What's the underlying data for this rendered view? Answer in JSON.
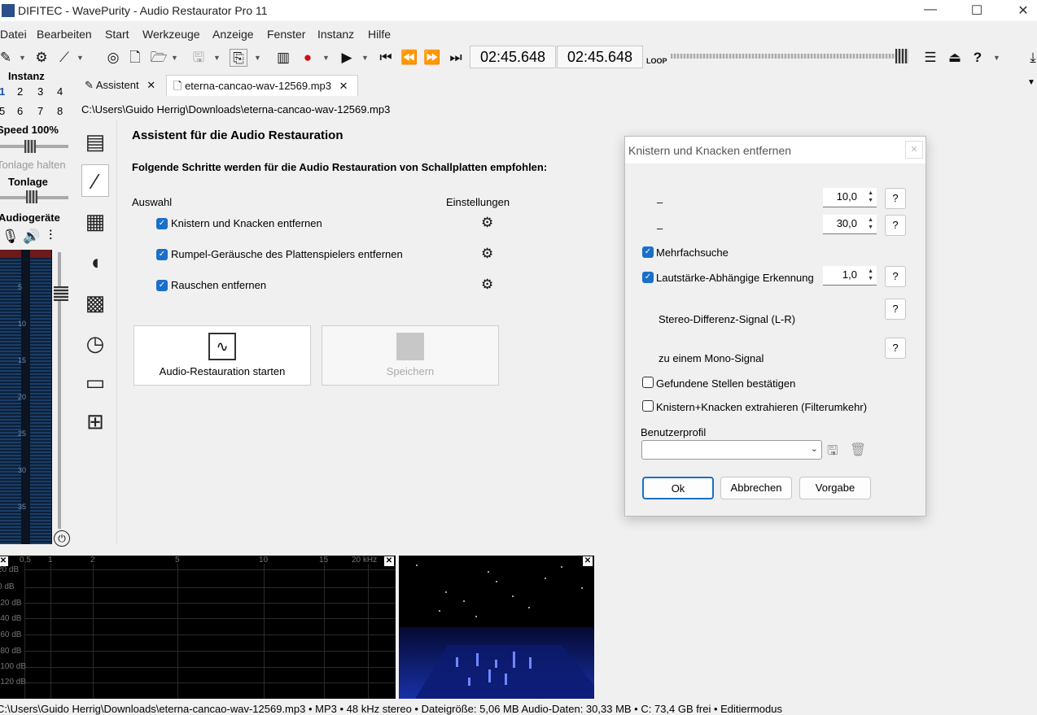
{
  "window": {
    "title": "DIFITEC - WavePurity - Audio Restaurator Pro 11",
    "minimize": "—",
    "maximize": "☐",
    "close": "✕"
  },
  "menu": [
    "Datei",
    "Bearbeiten",
    "Start",
    "Werkzeuge",
    "Anzeige",
    "Fenster",
    "Instanz",
    "Hilfe"
  ],
  "toolbar": {
    "time1": "02:45.648",
    "time2": "02:45.648",
    "loop_label": "LOOP"
  },
  "left_panel": {
    "instanz_label": "Instanz",
    "instanz_numbers": [
      "1",
      "2",
      "3",
      "4",
      "5",
      "6",
      "7",
      "8"
    ],
    "speed_label": "Speed 100%",
    "tonlage_halten": "Tonlage halten",
    "tonlage_label": "Tonlage",
    "audiogeraete_label": "Audiogeräte",
    "meter_labels": [
      "5",
      "10",
      "15",
      "20",
      "25",
      "30",
      "35"
    ]
  },
  "tabs": [
    {
      "label": "Assistent",
      "close": "✕"
    },
    {
      "label": "eterna-cancao-wav-12569.mp3",
      "close": "✕"
    }
  ],
  "path": "C:\\Users\\Guido Herrig\\Downloads\\eterna-cancao-wav-12569.mp3",
  "assistant": {
    "title": "Assistent für die Audio Restauration",
    "subtitle": "Folgende Schritte werden für die Audio Restauration von Schallplatten empfohlen:",
    "col_select": "Auswahl",
    "col_settings": "Einstellungen",
    "steps": [
      {
        "label": "Knistern und Knacken entfernen",
        "checked": true
      },
      {
        "label": "Rumpel-Geräusche des Plattenspielers entfernen",
        "checked": true
      },
      {
        "label": "Rauschen entfernen",
        "checked": true
      }
    ],
    "start_button": "Audio-Restauration starten",
    "save_button": "Speichern"
  },
  "dialog": {
    "title": "Knistern und Knacken entfernen",
    "row1_label": "–",
    "row1_value": "10,0",
    "row2_label": "–",
    "row2_value": "30,0",
    "mehrfachsuche": "Mehrfachsuche",
    "lautstaerke": "Lautstärke-Abhängige Erkennung",
    "lautstaerke_value": "1,0",
    "stereo_diff": "Stereo-Differenz-Signal (L-R)",
    "mono": "zu einem Mono-Signal",
    "gefundene": "Gefundene Stellen bestätigen",
    "extrahieren": "Knistern+Knacken extrahieren (Filterumkehr)",
    "benutzerprofil": "Benutzerprofil",
    "help": "?",
    "ok": "Ok",
    "abbrechen": "Abbrechen",
    "vorgabe": "Vorgabe"
  },
  "spectrum": {
    "x_labels": [
      "0,5",
      "1",
      "2",
      "5",
      "10",
      "15",
      "20 kHz"
    ],
    "y_labels": [
      "20 dB",
      "0 dB",
      "-20 dB",
      "-40 dB",
      "-60 dB",
      "-80 dB",
      "-100 dB",
      "-120 dB"
    ]
  },
  "status": "C:\\Users\\Guido Herrig\\Downloads\\eterna-cancao-wav-12569.mp3 • MP3 • 48 kHz stereo • Dateigröße: 5,06 MB   Audio-Daten: 30,33 MB • C: 73,4 GB frei • Editiermodus"
}
